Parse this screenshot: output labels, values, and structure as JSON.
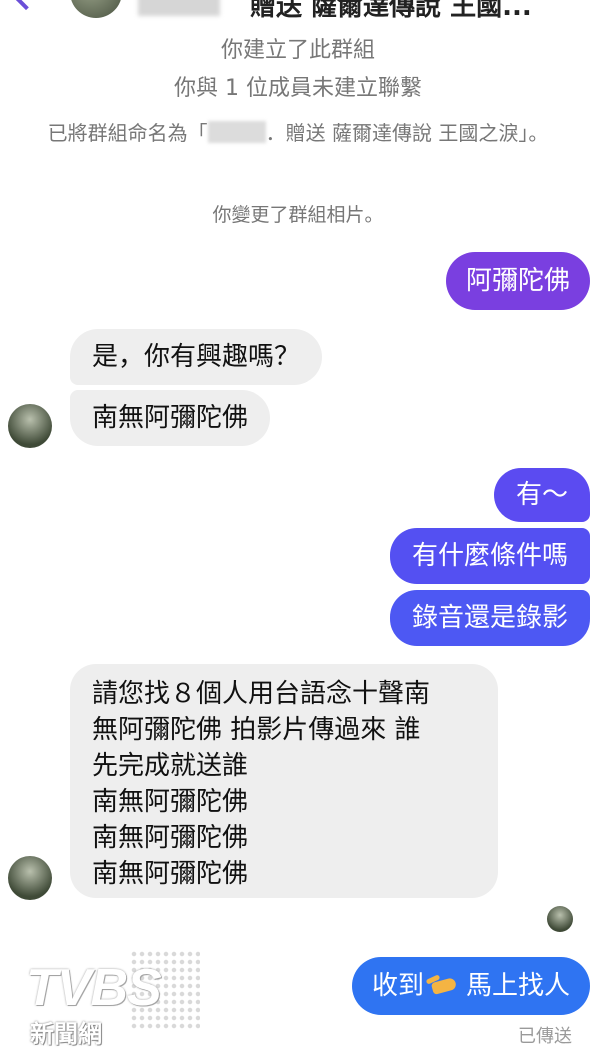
{
  "header": {
    "title": "贈送 薩爾達傳說 王國..."
  },
  "system": {
    "created": "你建立了此群組",
    "not_connected": "你與 1 位成員未建立聯繫",
    "renamed_prefix": "已將群組命名為「",
    "renamed_suffix": "．贈送 薩爾達傳說 王國之淚」。",
    "photo_changed": "你變更了群組相片。"
  },
  "messages": [
    {
      "text": "阿彌陀佛"
    },
    {
      "text": "是，你有興趣嗎？"
    },
    {
      "text": "南無阿彌陀佛"
    },
    {
      "text": "有～"
    },
    {
      "text": "有什麼條件嗎"
    },
    {
      "text": "錄音還是錄影"
    },
    {
      "lines": [
        "請您找８個人用台語念十聲南",
        "無阿彌陀佛 拍影片傳過來 誰",
        "先完成就送誰",
        "南無阿彌陀佛",
        "南無阿彌陀佛",
        "南無阿彌陀佛"
      ]
    },
    {
      "text_before": "收到",
      "icon": "pointing-hand-icon",
      "text_after": "馬上找人"
    }
  ],
  "status": "已傳送",
  "watermark": {
    "logo": "TVBS",
    "sub": "新聞網"
  },
  "colors": {
    "accent_purple": "#7a3fe0",
    "accent_blue": "#2f74f2",
    "incoming_bg": "#eeeeee"
  }
}
